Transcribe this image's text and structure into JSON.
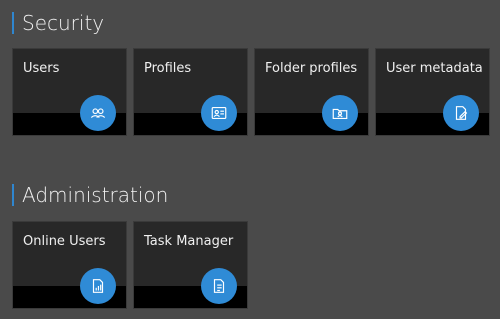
{
  "sections": [
    {
      "title": "Security",
      "tiles": [
        {
          "label": "Users",
          "icon": "users-icon"
        },
        {
          "label": "Profiles",
          "icon": "profile-card-icon"
        },
        {
          "label": "Folder profiles",
          "icon": "folder-profile-icon"
        },
        {
          "label": "User metadata",
          "icon": "edit-document-icon"
        }
      ]
    },
    {
      "title": "Administration",
      "tiles": [
        {
          "label": "Online Users",
          "icon": "chart-document-icon"
        },
        {
          "label": "Task Manager",
          "icon": "task-list-icon"
        }
      ]
    }
  ],
  "colors": {
    "background": "#4a4a4a",
    "tile": "#282828",
    "tile_footer": "#000000",
    "accent": "#2f8bd6"
  }
}
